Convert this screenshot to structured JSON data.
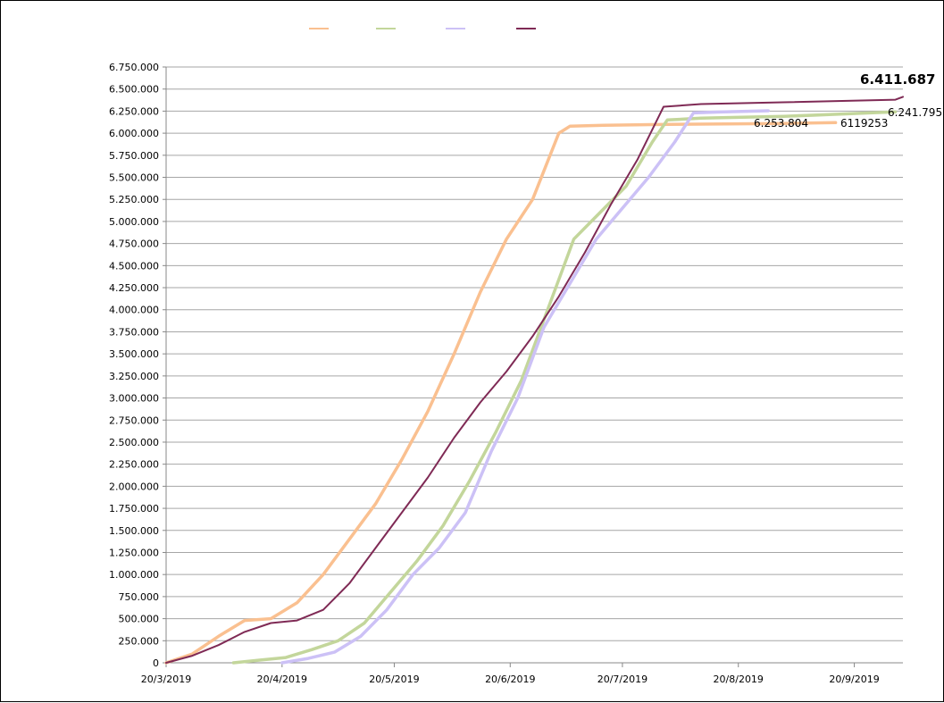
{
  "chart_data": {
    "type": "line",
    "title": "",
    "xlabel": "",
    "ylabel": "",
    "grid": true,
    "legend_position": "top",
    "xlim": [
      "2019-03-20",
      "2019-10-03"
    ],
    "ylim": [
      0,
      6750000
    ],
    "y_ticks": [
      0,
      250000,
      500000,
      750000,
      1000000,
      1250000,
      1500000,
      1750000,
      2000000,
      2250000,
      2500000,
      2750000,
      3000000,
      3250000,
      3500000,
      3750000,
      4000000,
      4250000,
      4500000,
      4750000,
      5000000,
      5250000,
      5500000,
      5750000,
      6000000,
      6250000,
      6500000,
      6750000
    ],
    "y_tick_labels": [
      "0",
      "250.000",
      "500.000",
      "750.000",
      "1.000.000",
      "1.250.000",
      "1.500.000",
      "1.750.000",
      "2.000.000",
      "2.250.000",
      "2.500.000",
      "2.750.000",
      "3.000.000",
      "3.250.000",
      "3.500.000",
      "3.750.000",
      "4.000.000",
      "4.250.000",
      "4.500.000",
      "4.750.000",
      "5.000.000",
      "5.250.000",
      "5.500.000",
      "5.750.000",
      "6.000.000",
      "6.250.000",
      "6.500.000",
      "6.750.000"
    ],
    "x_ticks": [
      "2019-03-20",
      "2019-04-20",
      "2019-05-20",
      "2019-06-20",
      "2019-07-20",
      "2019-08-20",
      "2019-09-20"
    ],
    "x_tick_labels": [
      "20/3/2019",
      "20/4/2019",
      "20/5/2019",
      "20/6/2019",
      "20/7/2019",
      "20/8/2019",
      "20/9/2019"
    ],
    "series": [
      {
        "color": "#fac090",
        "points": [
          [
            "2019-03-20",
            0
          ],
          [
            "2019-03-27",
            100000
          ],
          [
            "2019-04-03",
            300000
          ],
          [
            "2019-04-10",
            480000
          ],
          [
            "2019-04-17",
            500000
          ],
          [
            "2019-04-24",
            680000
          ],
          [
            "2019-05-01",
            1000000
          ],
          [
            "2019-05-08",
            1400000
          ],
          [
            "2019-05-15",
            1800000
          ],
          [
            "2019-05-22",
            2300000
          ],
          [
            "2019-05-29",
            2850000
          ],
          [
            "2019-06-05",
            3500000
          ],
          [
            "2019-06-12",
            4200000
          ],
          [
            "2019-06-19",
            4800000
          ],
          [
            "2019-06-26",
            5250000
          ],
          [
            "2019-07-03",
            6000000
          ],
          [
            "2019-07-06",
            6080000
          ],
          [
            "2019-07-15",
            6090000
          ],
          [
            "2019-08-01",
            6100000
          ],
          [
            "2019-09-01",
            6110000
          ],
          [
            "2019-09-15",
            6119253
          ]
        ],
        "end_label": "6119253"
      },
      {
        "color": "#c3d69b",
        "points": [
          [
            "2019-04-07",
            0
          ],
          [
            "2019-04-14",
            30000
          ],
          [
            "2019-04-21",
            60000
          ],
          [
            "2019-04-28",
            150000
          ],
          [
            "2019-05-05",
            250000
          ],
          [
            "2019-05-12",
            450000
          ],
          [
            "2019-05-19",
            800000
          ],
          [
            "2019-05-26",
            1150000
          ],
          [
            "2019-06-02",
            1550000
          ],
          [
            "2019-06-09",
            2050000
          ],
          [
            "2019-06-16",
            2600000
          ],
          [
            "2019-06-23",
            3200000
          ],
          [
            "2019-06-30",
            4000000
          ],
          [
            "2019-07-07",
            4800000
          ],
          [
            "2019-07-14",
            5100000
          ],
          [
            "2019-07-21",
            5400000
          ],
          [
            "2019-07-28",
            5900000
          ],
          [
            "2019-08-01",
            6150000
          ],
          [
            "2019-08-10",
            6170000
          ],
          [
            "2019-09-01",
            6190000
          ],
          [
            "2019-10-01",
            6241795
          ]
        ],
        "end_label": "6.241.795"
      },
      {
        "color": "#ccc1f6",
        "points": [
          [
            "2019-04-20",
            0
          ],
          [
            "2019-04-27",
            50000
          ],
          [
            "2019-05-04",
            120000
          ],
          [
            "2019-05-11",
            300000
          ],
          [
            "2019-05-18",
            600000
          ],
          [
            "2019-05-25",
            1000000
          ],
          [
            "2019-06-01",
            1300000
          ],
          [
            "2019-06-08",
            1700000
          ],
          [
            "2019-06-15",
            2400000
          ],
          [
            "2019-06-22",
            3000000
          ],
          [
            "2019-06-29",
            3800000
          ],
          [
            "2019-07-06",
            4300000
          ],
          [
            "2019-07-13",
            4800000
          ],
          [
            "2019-07-20",
            5150000
          ],
          [
            "2019-07-27",
            5500000
          ],
          [
            "2019-08-03",
            5900000
          ],
          [
            "2019-08-08",
            6230000
          ],
          [
            "2019-08-15",
            6240000
          ],
          [
            "2019-08-28",
            6253804
          ]
        ],
        "end_label": "6.253.804"
      },
      {
        "color": "#7f2a55",
        "points": [
          [
            "2019-03-20",
            0
          ],
          [
            "2019-03-27",
            80000
          ],
          [
            "2019-04-03",
            200000
          ],
          [
            "2019-04-10",
            350000
          ],
          [
            "2019-04-17",
            450000
          ],
          [
            "2019-04-24",
            480000
          ],
          [
            "2019-05-01",
            600000
          ],
          [
            "2019-05-08",
            900000
          ],
          [
            "2019-05-15",
            1300000
          ],
          [
            "2019-05-22",
            1700000
          ],
          [
            "2019-05-29",
            2100000
          ],
          [
            "2019-06-05",
            2550000
          ],
          [
            "2019-06-12",
            2950000
          ],
          [
            "2019-06-19",
            3300000
          ],
          [
            "2019-06-26",
            3700000
          ],
          [
            "2019-07-03",
            4150000
          ],
          [
            "2019-07-10",
            4650000
          ],
          [
            "2019-07-17",
            5200000
          ],
          [
            "2019-07-24",
            5700000
          ],
          [
            "2019-07-31",
            6300000
          ],
          [
            "2019-08-10",
            6330000
          ],
          [
            "2019-09-01",
            6350000
          ],
          [
            "2019-10-01",
            6380000
          ],
          [
            "2019-10-03",
            6411687
          ]
        ],
        "end_label": "6.411.687"
      }
    ]
  }
}
